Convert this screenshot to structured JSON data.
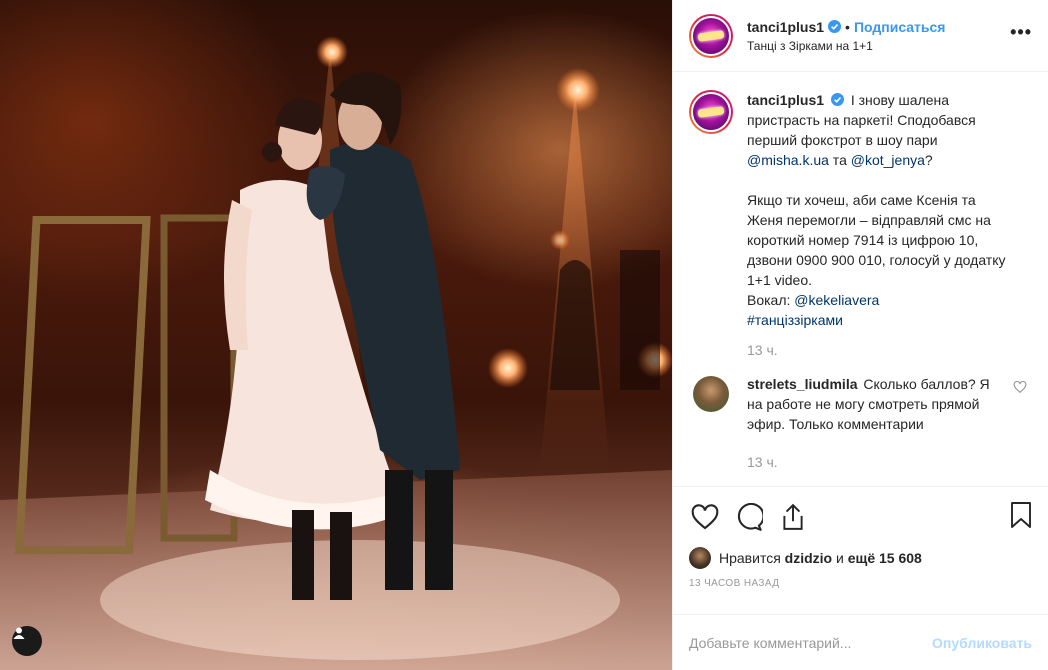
{
  "post": {
    "username": "tanci1plus1",
    "follow_label": "Подписаться",
    "location": "Танці з Зірками на 1+1",
    "more_label": "•••"
  },
  "caption": {
    "username": "tanci1plus1",
    "line1": "І знову шалена пристрасть на паркеті! Сподобався перший фокстрот в шоу пари ",
    "mention1": "@misha.k.ua",
    "and_word": " та ",
    "mention2": "@kot_jenya",
    "q_mark": "?",
    "paragraph2": "Якщо ти хочеш, аби саме Ксенія та Женя перемогли – відправляй смс на короткий номер 7914 із цифрою 10, дзвони 0900 900 010, голосуй у додатку 1+1 video.",
    "vocal_label": "Вокал: ",
    "mention3": "@kekeliavera",
    "hashtag": "#танціззірками",
    "time": "13 ч."
  },
  "comment": {
    "username": "strelets_liudmila",
    "text": "Сколько баллов? Я на работе не могу смотреть прямой эфир. Только комментарии",
    "time_cut": "13 ч."
  },
  "likes": {
    "prefix": "Нравится",
    "user": "dzidzio",
    "and_word": "и",
    "count": "ещё 15 608"
  },
  "timeago": "13 часов назад",
  "add_comment": {
    "placeholder": "Добавьте комментарий...",
    "publish_label": "Опубликовать"
  },
  "colors": {
    "link": "#3897f0",
    "mention": "#003569",
    "muted": "#999999",
    "publish_disabled": "#b3dbff"
  },
  "icons": [
    "verified-badge-icon",
    "more-options-icon",
    "heart-icon",
    "comment-icon",
    "share-icon",
    "bookmark-icon",
    "user-menu-icon"
  ]
}
